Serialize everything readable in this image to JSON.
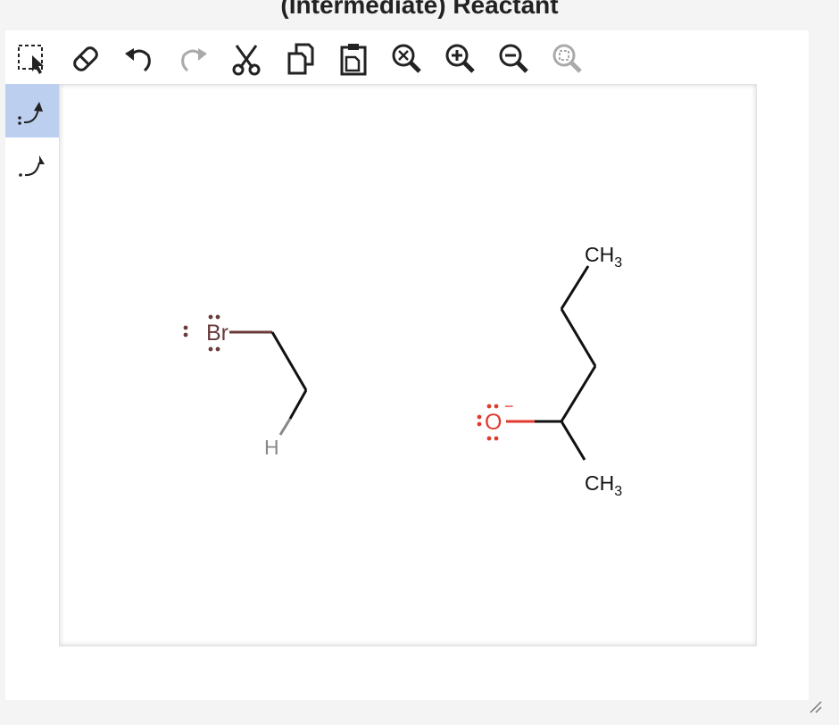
{
  "header": {
    "title": "(Intermediate) Reactant"
  },
  "toolbar": {
    "tools": [
      {
        "name": "select-tool",
        "icon": "marquee-select-icon",
        "enabled": true
      },
      {
        "name": "erase-tool",
        "icon": "eraser-icon",
        "enabled": true
      },
      {
        "name": "undo-button",
        "icon": "undo-icon",
        "enabled": true
      },
      {
        "name": "redo-button",
        "icon": "redo-icon",
        "enabled": false
      },
      {
        "name": "cut-button",
        "icon": "scissors-icon",
        "enabled": true
      },
      {
        "name": "copy-button",
        "icon": "copy-icon",
        "enabled": true
      },
      {
        "name": "paste-button",
        "icon": "clipboard-icon",
        "enabled": true
      },
      {
        "name": "zoom-reset-button",
        "icon": "zoom-reset-icon",
        "enabled": true
      },
      {
        "name": "zoom-in-button",
        "icon": "zoom-in-icon",
        "enabled": true
      },
      {
        "name": "zoom-out-button",
        "icon": "zoom-out-icon",
        "enabled": true
      },
      {
        "name": "zoom-fit-button",
        "icon": "zoom-fit-icon",
        "enabled": false
      }
    ]
  },
  "side_tools": [
    {
      "name": "electron-pair-arrow-tool",
      "icon": "curved-arrow-pair-icon",
      "active": true
    },
    {
      "name": "single-electron-arrow-tool",
      "icon": "curved-arrow-single-icon",
      "active": false
    }
  ],
  "molecules": {
    "bromoethane": {
      "br_label": "Br",
      "h_label": "H",
      "br_color": "#6b3a3a",
      "h_color": "#888888"
    },
    "alkoxide": {
      "o_label": "O",
      "o_charge": "−",
      "o_color": "#e03a2f",
      "top_ch3": {
        "main": "CH",
        "sub": "3"
      },
      "bottom_ch3": {
        "main": "CH",
        "sub": "3"
      }
    }
  },
  "colors": {
    "accent_active": "#bccfee",
    "bond": "#111111",
    "icon": "#222222",
    "icon_disabled": "#aaaaaa"
  }
}
